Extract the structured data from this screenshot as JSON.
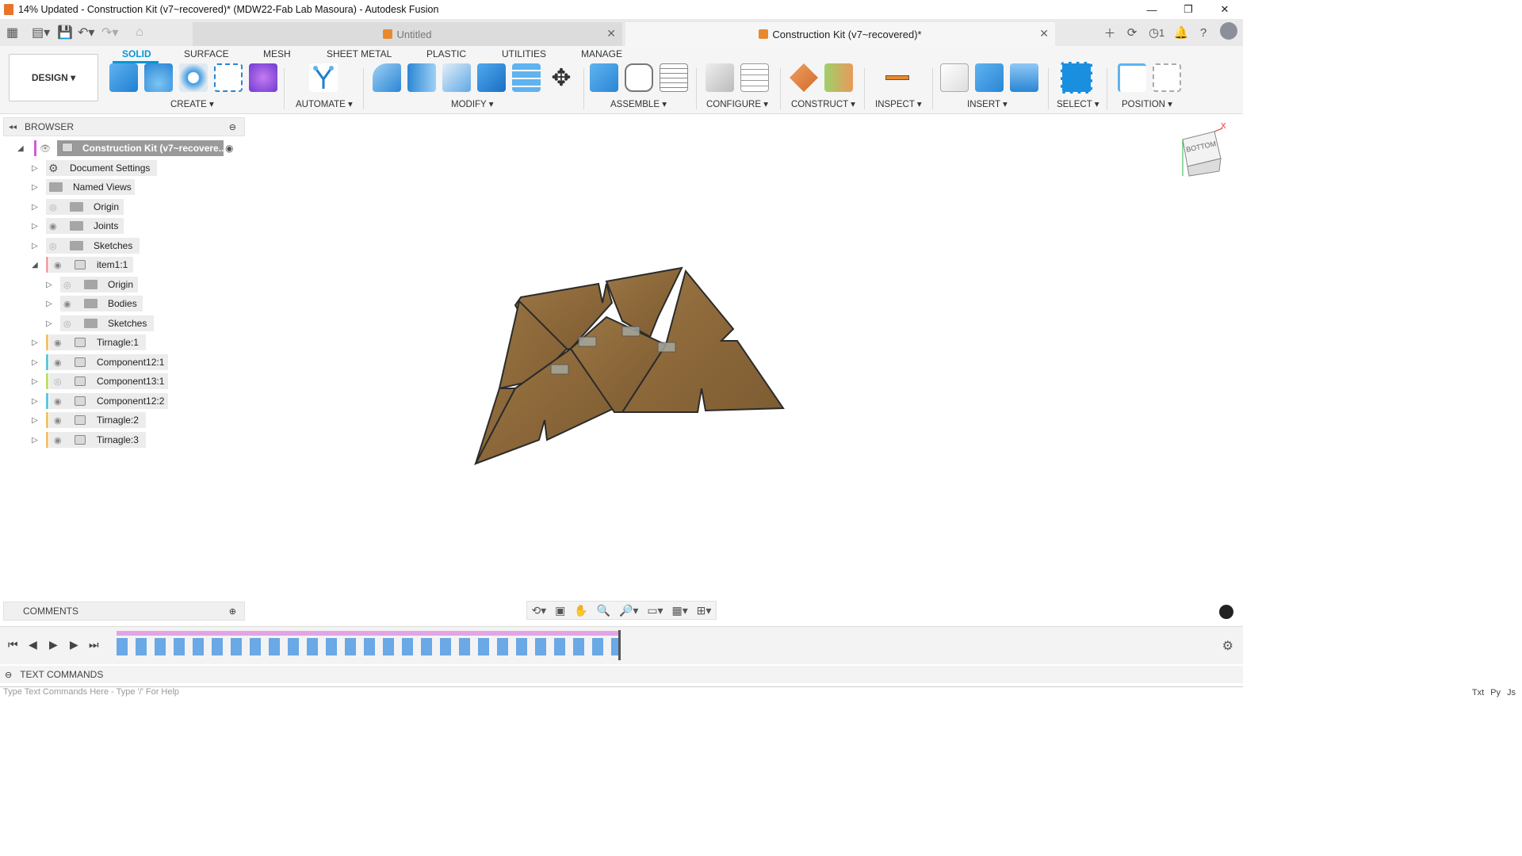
{
  "window": {
    "title": "14% Updated - Construction Kit (v7~recovered)* (MDW22-Fab Lab Masoura) - Autodesk Fusion",
    "controls": [
      "—",
      "❐",
      "✕"
    ]
  },
  "tabs": [
    {
      "label": "Untitled",
      "active": false
    },
    {
      "label": "Construction Kit (v7~recovered)*",
      "active": true
    }
  ],
  "tabbar_right": {
    "jobs_count": "1"
  },
  "workspace": {
    "mode_label": "DESIGN ▾"
  },
  "toolbar_tabs": [
    "SOLID",
    "SURFACE",
    "MESH",
    "SHEET METAL",
    "PLASTIC",
    "UTILITIES",
    "MANAGE"
  ],
  "toolbar_groups": [
    "CREATE ▾",
    "AUTOMATE ▾",
    "MODIFY ▾",
    "ASSEMBLE ▾",
    "CONFIGURE ▾",
    "CONSTRUCT ▾",
    "INSPECT ▾",
    "INSERT ▾",
    "SELECT ▾",
    "POSITION ▾"
  ],
  "browser": {
    "title": "BROWSER",
    "root": "Construction Kit (v7~recovere...",
    "items": [
      "Document Settings",
      "Named Views",
      "Origin",
      "Joints",
      "Sketches",
      "item1:1",
      "Origin",
      "Bodies",
      "Sketches",
      "Tirnagle:1",
      "Component12:1",
      "Component13:1",
      "Component12:2",
      "Tirnagle:2",
      "Tirnagle:3"
    ]
  },
  "comments": {
    "label": "COMMENTS"
  },
  "text_commands": {
    "label": "TEXT COMMANDS",
    "placeholder": "Type Text Commands Here - Type '/' For Help",
    "modes": [
      "Txt",
      "Py",
      "Js"
    ]
  },
  "viewcube": {
    "face": "BOTTOM",
    "axis": "X"
  },
  "colors": {
    "accent": "#0696d7",
    "wood": "#8f6a3c"
  }
}
